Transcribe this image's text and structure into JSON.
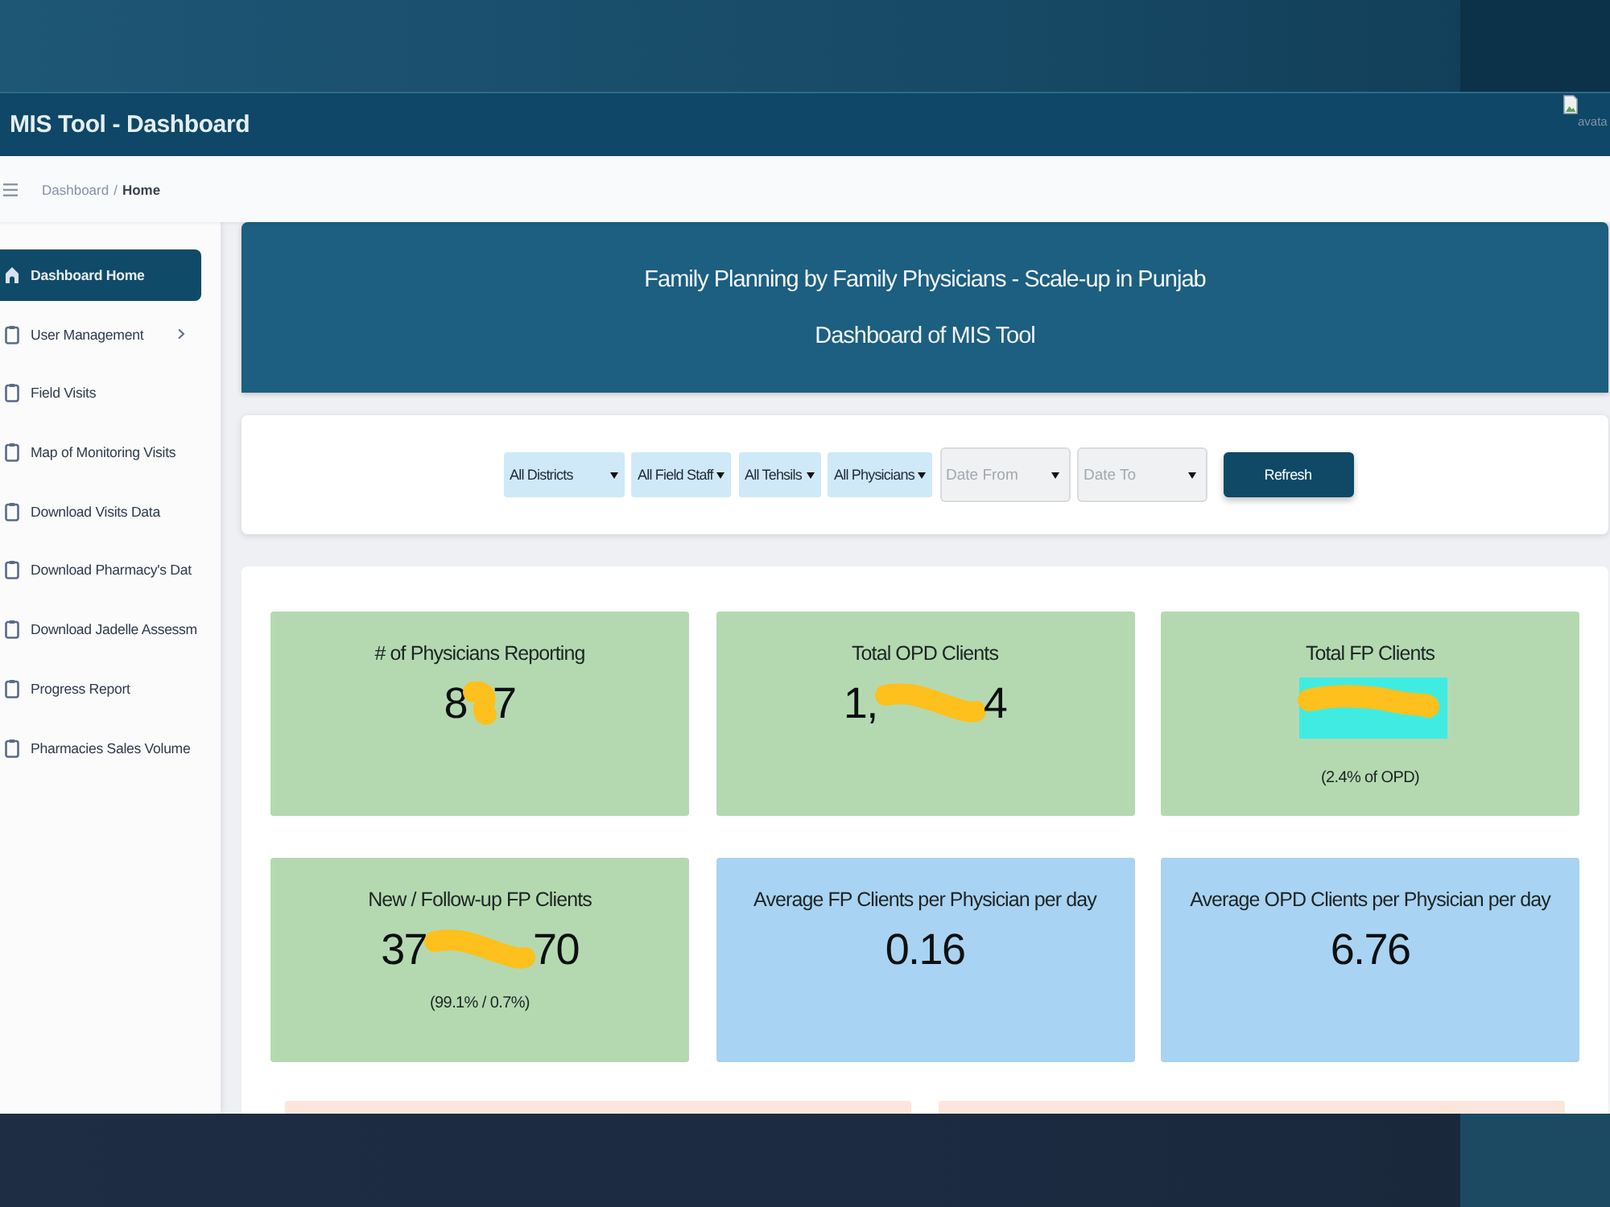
{
  "app_bar": {
    "title": "MIS Tool - Dashboard",
    "avatar_alt": "avata"
  },
  "breadcrumb": {
    "parent": "Dashboard",
    "separator": "/",
    "current": "Home"
  },
  "sidebar": {
    "items": [
      {
        "label": "Dashboard Home",
        "selected": true,
        "has_submenu": false
      },
      {
        "label": "User Management",
        "selected": false,
        "has_submenu": true
      },
      {
        "label": "Field Visits",
        "selected": false,
        "has_submenu": false
      },
      {
        "label": "Map of Monitoring Visits",
        "selected": false,
        "has_submenu": false
      },
      {
        "label": "Download Visits Data",
        "selected": false,
        "has_submenu": false
      },
      {
        "label": "Download Pharmacy's Dat",
        "selected": false,
        "has_submenu": false
      },
      {
        "label": "Download Jadelle Assessm",
        "selected": false,
        "has_submenu": false
      },
      {
        "label": "Progress Report",
        "selected": false,
        "has_submenu": false
      },
      {
        "label": "Pharmacies Sales Volume",
        "selected": false,
        "has_submenu": false
      }
    ]
  },
  "banner": {
    "title": "Family Planning by Family Physicians - Scale-up in Punjab",
    "subtitle": "Dashboard of MIS Tool"
  },
  "filters": {
    "fields": [
      {
        "kind": "select",
        "value": "All Districts"
      },
      {
        "kind": "select",
        "value": "All Field Staff"
      },
      {
        "kind": "select",
        "value": "All Tehsils"
      },
      {
        "kind": "select",
        "value": "All Physicians"
      },
      {
        "kind": "date",
        "placeholder": "Date From"
      },
      {
        "kind": "date",
        "placeholder": "Date To"
      }
    ],
    "button": "Refresh"
  },
  "stats": {
    "cards": [
      {
        "kind": "dab",
        "title": "# of Physicians Reporting",
        "color": "#b4d9b1",
        "value_before": "8",
        "value_after": "7"
      },
      {
        "kind": "stroke",
        "title": "Total OPD Clients",
        "color": "#b4d9b1",
        "value_before": "1,",
        "value_after": "4"
      },
      {
        "kind": "highlight",
        "title": "Total FP Clients",
        "color": "#b4d9b1",
        "note": "(2.4% of OPD)"
      },
      {
        "kind": "stroke",
        "title": "New / Follow-up FP Clients",
        "color": "#b4d9b1",
        "value_before": "37",
        "value_after": "70",
        "note": "(99.1% / 0.7%)"
      },
      {
        "kind": "plain",
        "title": "Average FP Clients per Physician per day",
        "color": "#a9d3f2",
        "value_before": "0.16"
      },
      {
        "kind": "plain",
        "title": "Average OPD Clients per Physician per day",
        "color": "#a9d3f2",
        "value_before": "6.76"
      }
    ]
  }
}
